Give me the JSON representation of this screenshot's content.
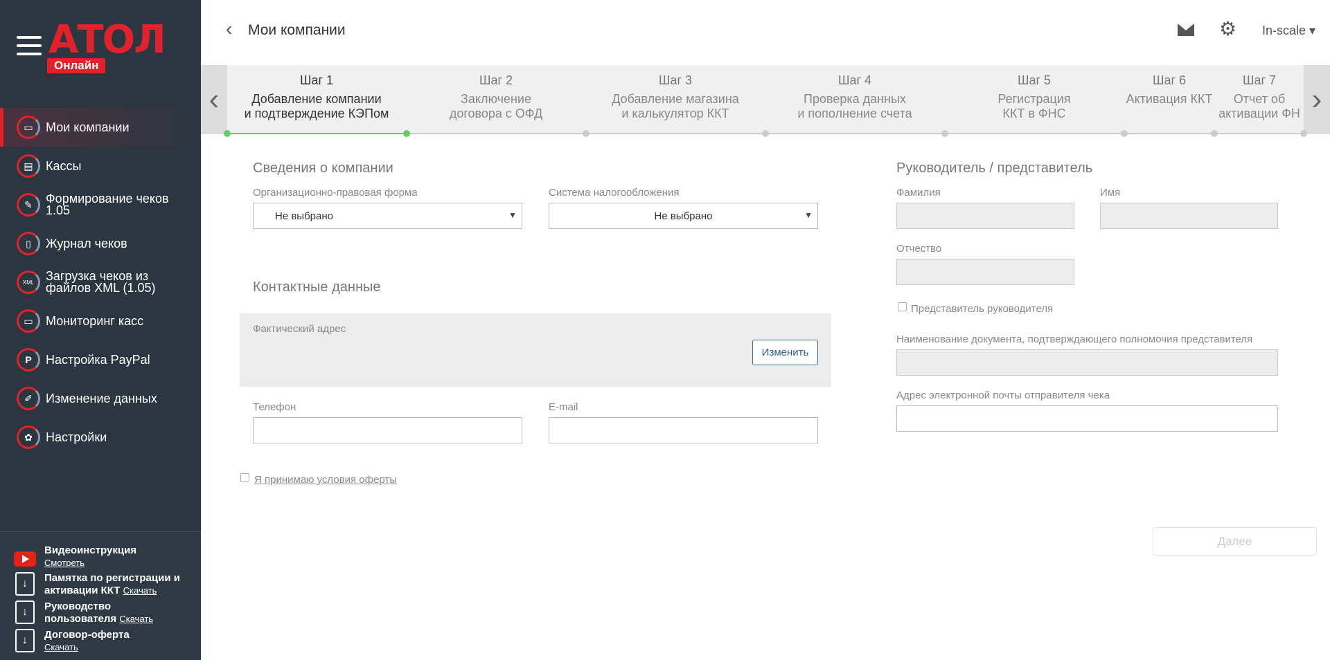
{
  "brand": {
    "logo": "АТОЛ",
    "badge": "Онлайн",
    "accent": "#e2222b"
  },
  "sidebar": {
    "items": [
      {
        "label": "Мои компании",
        "icon": "store-icon",
        "active": true
      },
      {
        "label": "Кассы",
        "icon": "cash-register-icon"
      },
      {
        "label": "Формирование чеков 1.05",
        "icon": "edit-receipt-icon"
      },
      {
        "label": "Журнал чеков",
        "icon": "receipt-log-icon"
      },
      {
        "label": "Загрузка чеков из файлов XML (1.05)",
        "icon": "xml-file-icon"
      },
      {
        "label": "Мониторинг касс",
        "icon": "monitor-icon"
      },
      {
        "label": "Настройка PayPal",
        "icon": "paypal-icon"
      },
      {
        "label": "Изменение данных",
        "icon": "pencil-icon"
      },
      {
        "label": "Настройки",
        "icon": "gear-icon"
      }
    ],
    "resources": [
      {
        "title": "Видеоинструкция",
        "title2": "",
        "link": "Смотреть",
        "icon": "youtube-icon"
      },
      {
        "title": "Памятка по регистрации и",
        "title2": "активации ККТ",
        "link": "Скачать",
        "icon": "download-icon"
      },
      {
        "title": "Руководство",
        "title2": "пользователя",
        "link": "Скачать",
        "icon": "download-icon"
      },
      {
        "title": "Договор-оферта",
        "title2": "",
        "link": "Скачать",
        "icon": "download-icon"
      }
    ]
  },
  "header": {
    "back": "‹",
    "title": "Мои компании",
    "user": "In-scale ▾"
  },
  "steps": [
    {
      "num": "Шаг 1",
      "line1": "Добавление компании",
      "line2": "и подтверждение КЭПом",
      "active": true
    },
    {
      "num": "Шаг 2",
      "line1": "Заключение",
      "line2": "договора с ОФД"
    },
    {
      "num": "Шаг 3",
      "line1": "Добавление магазина",
      "line2": "и калькулятор ККТ"
    },
    {
      "num": "Шаг 4",
      "line1": "Проверка данных",
      "line2": "и пополнение счета"
    },
    {
      "num": "Шаг 5",
      "line1": "Регистрация",
      "line2": "ККТ в ФНС"
    },
    {
      "num": "Шаг 6",
      "line1": "Активация ККТ",
      "line2": ""
    },
    {
      "num": "Шаг 7",
      "line1": "Отчет об",
      "line2": "активации ФН"
    }
  ],
  "company": {
    "title": "Сведения о компании",
    "legal_form_label": "Организационно-правовая форма",
    "legal_form_value": "Не выбрано",
    "tax_label": "Система налогообложения",
    "tax_value": "Не выбрано"
  },
  "contacts": {
    "title": "Контактные данные",
    "address_label": "Фактический адрес",
    "change_button": "Изменить",
    "phone_label": "Телефон",
    "email_label": "E-mail"
  },
  "offer": {
    "label": "Я принимаю условия оферты"
  },
  "head": {
    "title": "Руководитель / представитель",
    "lastname_label": "Фамилия",
    "firstname_label": "Имя",
    "patronymic_label": "Отчество",
    "representative_label": "Представитель руководителя",
    "doc_label": "Наименование документа, подтверждающего полномочия представителя",
    "sender_email_label": "Адрес электронной почты отправителя чека"
  },
  "footer": {
    "next_button": "Далее"
  }
}
